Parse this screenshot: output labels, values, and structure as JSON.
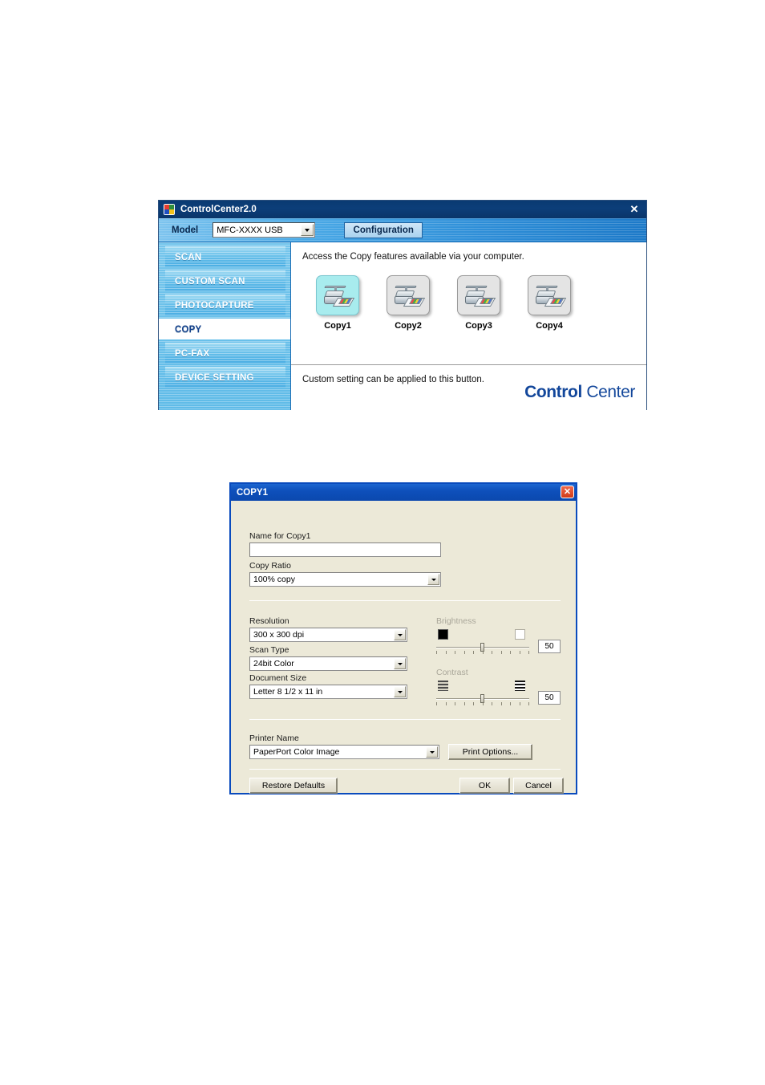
{
  "control_center": {
    "title": "ControlCenter2.0",
    "app_icon": "controlcenter-app-icon",
    "close_icon": "✕",
    "model_label": "Model",
    "model_value": "MFC-XXXX USB",
    "configuration_label": "Configuration",
    "sidebar_items": [
      {
        "label": "SCAN",
        "active": false
      },
      {
        "label": "CUSTOM SCAN",
        "active": false
      },
      {
        "label": "PHOTOCAPTURE",
        "active": false
      },
      {
        "label": "COPY",
        "active": true
      },
      {
        "label": "PC-FAX",
        "active": false
      },
      {
        "label": "DEVICE SETTING",
        "active": false
      }
    ],
    "intro_text": "Access the Copy features available via your computer.",
    "copy_buttons": [
      {
        "label": "Copy1",
        "selected": true
      },
      {
        "label": "Copy2",
        "selected": false
      },
      {
        "label": "Copy3",
        "selected": false
      },
      {
        "label": "Copy4",
        "selected": false
      }
    ],
    "footer_text": "Custom setting can be applied to this button.",
    "logo_bold": "Control",
    "logo_light": " Center",
    "accent_blue": "#13479b",
    "selected_tile_color": "#a8ecee"
  },
  "copy_dialog": {
    "title": "COPY1",
    "close_icon": "✕",
    "name_label": "Name for Copy1",
    "name_value": "",
    "copy_ratio_label": "Copy Ratio",
    "copy_ratio_value": "100% copy",
    "resolution_label": "Resolution",
    "resolution_value": "300 x 300 dpi",
    "scan_type_label": "Scan Type",
    "scan_type_value": "24bit Color",
    "document_size_label": "Document Size",
    "document_size_value": "Letter 8 1/2 x 11 in",
    "brightness_label": "Brightness",
    "brightness_value": "50",
    "contrast_label": "Contrast",
    "contrast_value": "50",
    "printer_name_label": "Printer Name",
    "printer_name_value": "PaperPort Color Image",
    "print_options_label": "Print Options...",
    "restore_defaults_label": "Restore Defaults",
    "ok_label": "OK",
    "cancel_label": "Cancel"
  }
}
